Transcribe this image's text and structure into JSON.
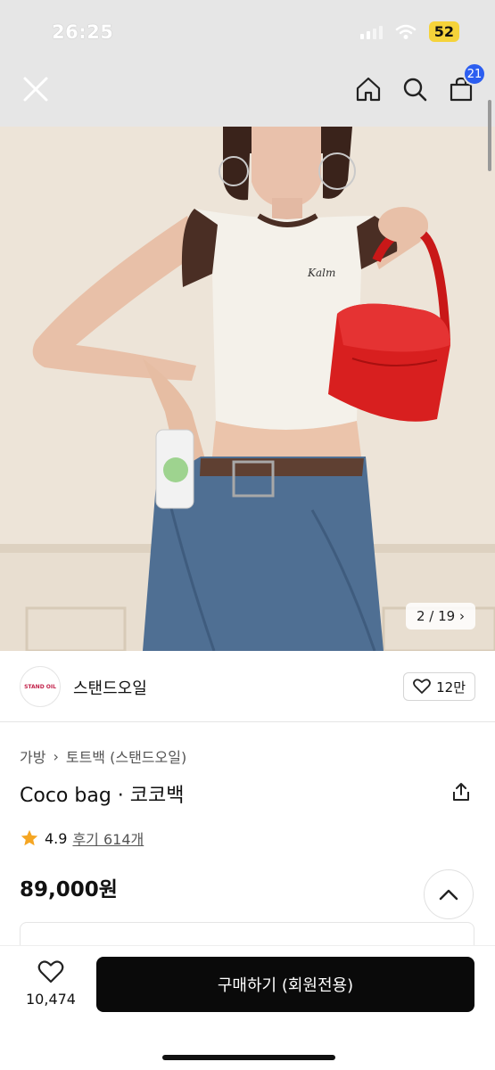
{
  "status": {
    "time": "26:25",
    "battery": "52"
  },
  "nav": {
    "cart_count": "21"
  },
  "gallery": {
    "counter": "2 / 19"
  },
  "brand": {
    "logo_text": "STAND OIL",
    "name": "스탠드오일",
    "likes": "12만"
  },
  "breadcrumb": {
    "category": "가방",
    "subcategory": "토트백 (스탠드오일)"
  },
  "product": {
    "title": "Coco bag · 코코백",
    "rating": "4.9",
    "reviews": "후기 614개",
    "price": "89,000원"
  },
  "bottom": {
    "wish_count": "10,474",
    "buy_label": "구매하기 (회원전용)"
  },
  "colors": {
    "accent": "#2c5ef0",
    "star": "#f5a623",
    "buy_button": "#0a0a0a",
    "bag": "#d91f1f"
  },
  "icons": [
    "close-icon",
    "home-icon",
    "search-icon",
    "shopping-bag-icon",
    "heart-icon",
    "share-icon",
    "star-icon",
    "chevron-up-icon",
    "chevron-right-icon"
  ]
}
